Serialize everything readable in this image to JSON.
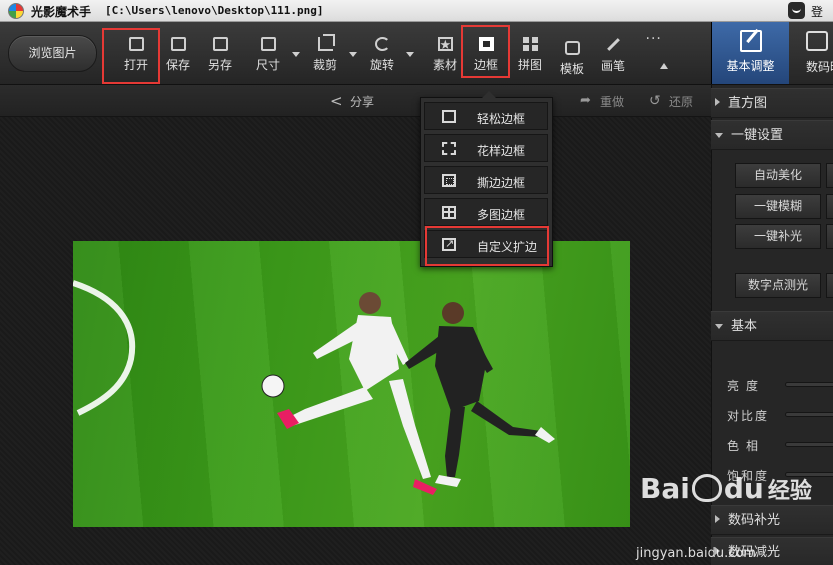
{
  "titlebar": {
    "app_name": "光影魔术手",
    "file_path": "[C:\\Users\\lenovo\\Desktop\\111.png]",
    "login": "登录"
  },
  "toolbar": {
    "browse": "浏览图片",
    "items": [
      {
        "label": "打开",
        "icon": "open-image-icon"
      },
      {
        "label": "保存",
        "icon": "save-icon"
      },
      {
        "label": "另存",
        "icon": "save-as-icon"
      },
      {
        "label": "尺寸",
        "icon": "resize-icon"
      },
      {
        "label": "裁剪",
        "icon": "crop-icon"
      },
      {
        "label": "旋转",
        "icon": "rotate-icon"
      },
      {
        "label": "素材",
        "icon": "material-icon"
      },
      {
        "label": "边框",
        "icon": "frame-icon"
      },
      {
        "label": "拼图",
        "icon": "collage-icon"
      },
      {
        "label": "模板",
        "icon": "template-icon"
      },
      {
        "label": "画笔",
        "icon": "brush-icon"
      }
    ],
    "more_icon": "more-dots-icon"
  },
  "right_tabs": {
    "basic": "基本调整",
    "digital": "数码暗房"
  },
  "subbar": {
    "share": "分享",
    "redo": "重做",
    "undo": "还原"
  },
  "frame_menu": {
    "items": [
      "轻松边框",
      "花样边框",
      "撕边边框",
      "多图边框",
      "自定义扩边"
    ]
  },
  "panel": {
    "histogram": "直方图",
    "one_click": "一键设置",
    "buttons": [
      "自动美化",
      "一键模糊",
      "一键补光",
      "数字点测光"
    ],
    "basic": "基本",
    "sliders": [
      "亮度",
      "对比度",
      "色相",
      "饱和度"
    ],
    "fill_light": "数码补光",
    "dim_light": "数码减光"
  },
  "watermark": {
    "brand": "Bai",
    "brand2": "du",
    "brand_cn": "经验",
    "url": "jingyan.baidu.com"
  },
  "colors": {
    "highlight": "#e53935",
    "active_tab": "#2f5a95",
    "grass": "#3d9e1a"
  }
}
